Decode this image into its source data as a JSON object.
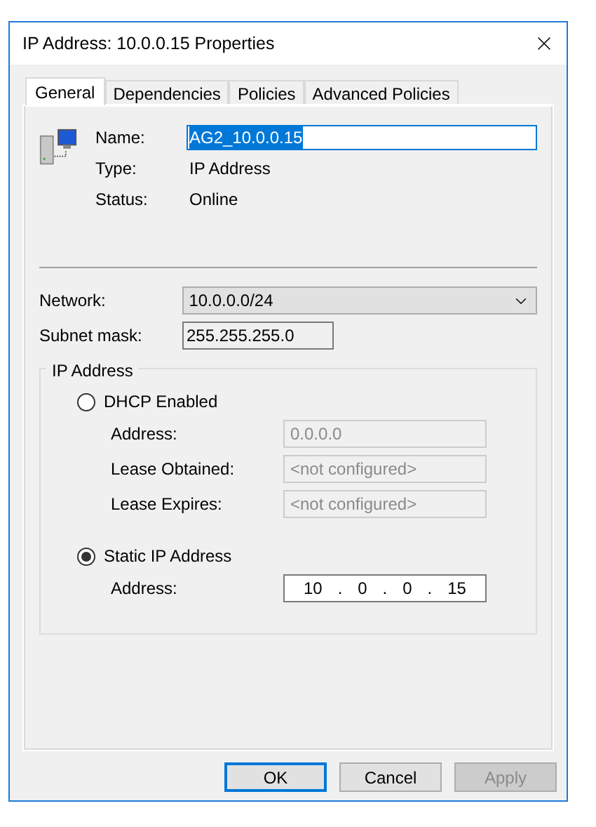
{
  "window": {
    "title": "IP Address: 10.0.0.15 Properties"
  },
  "tabs": [
    {
      "label": "General",
      "selected": true
    },
    {
      "label": "Dependencies",
      "selected": false
    },
    {
      "label": "Policies",
      "selected": false
    },
    {
      "label": "Advanced Policies",
      "selected": false
    }
  ],
  "summary": {
    "name_label": "Name:",
    "name_value": "AG2_10.0.0.15",
    "type_label": "Type:",
    "type_value": "IP Address",
    "status_label": "Status:",
    "status_value": "Online"
  },
  "network": {
    "label": "Network:",
    "value": "10.0.0.0/24"
  },
  "subnet_mask": {
    "label": "Subnet mask:",
    "value": "255.255.255.0"
  },
  "ip_address_group": {
    "title": "IP Address",
    "options": [
      {
        "label": "DHCP Enabled",
        "selected": false,
        "fields": [
          {
            "label": "Address:",
            "value": "0.0.0.0",
            "disabled": true
          },
          {
            "label": "Lease Obtained:",
            "value": "<not configured>",
            "disabled": true
          },
          {
            "label": "Lease Expires:",
            "value": "<not configured>",
            "disabled": true
          }
        ]
      },
      {
        "label": "Static IP Address",
        "selected": true,
        "fields": [
          {
            "label": "Address:",
            "octets": [
              "10",
              "0",
              "0",
              "15"
            ],
            "separator": ".",
            "disabled": false
          }
        ]
      }
    ]
  },
  "buttons": [
    {
      "label": "OK",
      "default": true,
      "disabled": false
    },
    {
      "label": "Cancel",
      "default": false,
      "disabled": false
    },
    {
      "label": "Apply",
      "default": false,
      "disabled": true
    }
  ]
}
